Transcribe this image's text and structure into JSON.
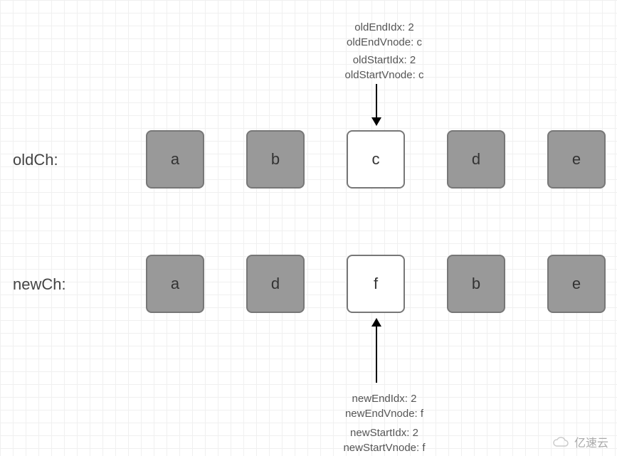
{
  "rows": {
    "old": {
      "label": "oldCh:",
      "items": [
        {
          "letter": "a",
          "highlight": false
        },
        {
          "letter": "b",
          "highlight": false
        },
        {
          "letter": "c",
          "highlight": true
        },
        {
          "letter": "d",
          "highlight": false
        },
        {
          "letter": "e",
          "highlight": false
        }
      ]
    },
    "new": {
      "label": "newCh:",
      "items": [
        {
          "letter": "a",
          "highlight": false
        },
        {
          "letter": "d",
          "highlight": false
        },
        {
          "letter": "f",
          "highlight": true
        },
        {
          "letter": "b",
          "highlight": false
        },
        {
          "letter": "e",
          "highlight": false
        }
      ]
    }
  },
  "topInfo": {
    "line1": "oldEndIdx:  2",
    "line2": "oldEndVnode:  c",
    "line3": "oldStartIdx:  2",
    "line4": "oldStartVnode:  c"
  },
  "bottomInfo": {
    "line1": "newEndIdx:  2",
    "line2": "newEndVnode:  f",
    "line3": "newStartIdx:  2",
    "line4": "newStartVnode:  f"
  },
  "watermark": "亿速云"
}
